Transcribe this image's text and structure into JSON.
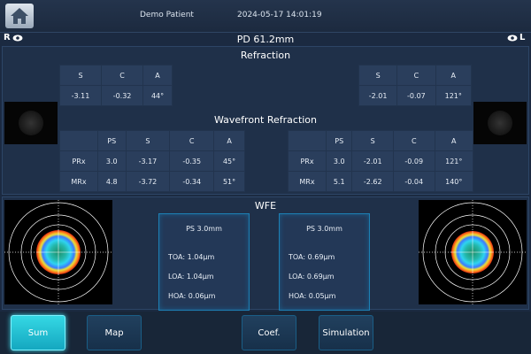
{
  "header": {
    "patient": "Demo Patient",
    "datetime": "2024-05-17 14:01:19"
  },
  "eyes": {
    "right": "R",
    "left": "L",
    "pd": "PD 61.2mm"
  },
  "refraction": {
    "title": "Refraction",
    "headers": [
      "S",
      "C",
      "A"
    ],
    "right": [
      "-3.11",
      "-0.32",
      "44°"
    ],
    "left": [
      "-2.01",
      "-0.07",
      "121°"
    ]
  },
  "wavefront": {
    "title": "Wavefront Refraction",
    "headers": [
      "PS",
      "S",
      "C",
      "A"
    ],
    "right": [
      {
        "label": "PRx",
        "values": [
          "3.0",
          "-3.17",
          "-0.35",
          "45°"
        ]
      },
      {
        "label": "MRx",
        "values": [
          "4.8",
          "-3.72",
          "-0.34",
          "51°"
        ]
      }
    ],
    "left": [
      {
        "label": "PRx",
        "values": [
          "3.0",
          "-2.01",
          "-0.09",
          "121°"
        ]
      },
      {
        "label": "MRx",
        "values": [
          "5.1",
          "-2.62",
          "-0.04",
          "140°"
        ]
      }
    ]
  },
  "wfe": {
    "title": "WFE",
    "right": {
      "ps": "PS 3.0mm",
      "toa": "TOA: 1.04μm",
      "loa": "LOA: 1.04μm",
      "hoa": "HOA: 0.06μm"
    },
    "left": {
      "ps": "PS 3.0mm",
      "toa": "TOA: 0.69μm",
      "loa": "LOA: 0.69μm",
      "hoa": "HOA: 0.05μm"
    }
  },
  "bottom_buttons": [
    "Sum",
    "Map",
    "Coef.",
    "Simulation"
  ],
  "colors": {
    "accent": "#35d8e4",
    "panel": "#1f3049",
    "cell": "#2a3e5c"
  }
}
